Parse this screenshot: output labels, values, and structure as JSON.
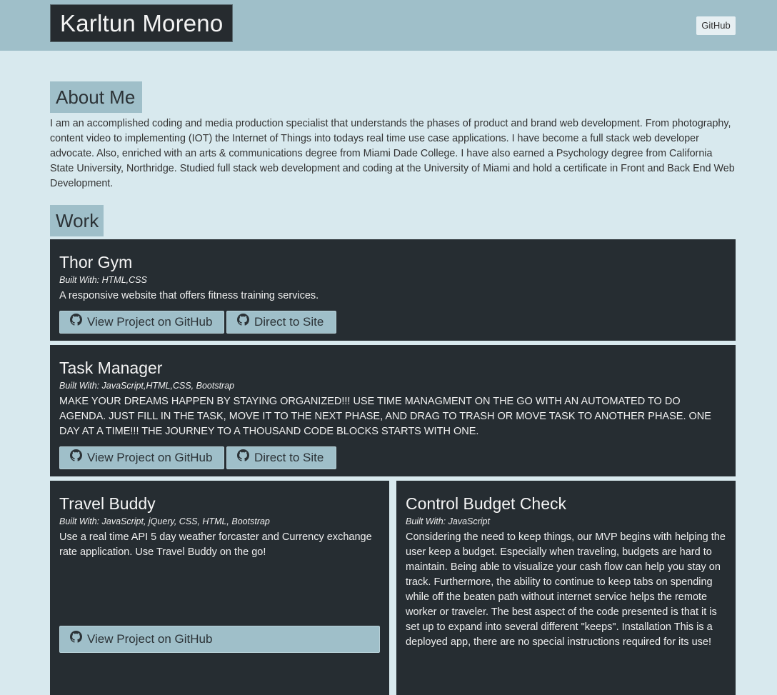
{
  "header": {
    "brand": "Karltun Moreno",
    "github_link": "GitHub"
  },
  "about": {
    "title": "About Me",
    "text": "I am an accomplished coding and media production specialist that understands the phases of product and brand web development. From photography, content video to implementing (IOT) the Internet of Things into todays real time use case applications. I have become a full stack web developer advocate. Also, enriched with an arts & communications degree from Miami Dade College. I have also earned a Psychology degree from California State University, Northridge. Studied full stack web development and coding at the University of Miami and hold a certificate in Front and Back End Web Development."
  },
  "work": {
    "title": "Work",
    "projects": [
      {
        "name": "Thor Gym",
        "built": "Built With: HTML,CSS",
        "description": "A responsive website that offers fitness training services.",
        "github_button": "View Project on GitHub",
        "site_button": "Direct to Site"
      },
      {
        "name": "Task Manager",
        "built": "Built With: JavaScript,HTML,CSS, Bootstrap",
        "description": "MAKE YOUR DREAMS HAPPEN BY STAYING ORGANIZED!!! USE TIME MANAGMENT ON THE GO WITH AN AUTOMATED TO DO AGENDA. JUST FILL IN THE TASK, MOVE IT TO THE NEXT PHASE, AND DRAG TO TRASH OR MOVE TASK TO ANOTHER PHASE. ONE DAY AT A TIME!!! THE JOURNEY TO A THOUSAND CODE BLOCKS STARTS WITH ONE.",
        "github_button": "View Project on GitHub",
        "site_button": "Direct to Site"
      },
      {
        "name": "Travel Buddy",
        "built": "Built With: JavaScript, jQuery, CSS, HTML, Bootstrap",
        "description": "Use a real time API 5 day weather forcaster and Currency exchange rate application. Use Travel Buddy on the go!",
        "github_button": "View Project on GitHub"
      },
      {
        "name": "Control Budget Check",
        "built": "Built With: JavaScript",
        "description": "Considering the need to keep things, our MVP begins with helping the user keep a budget. Especially when traveling, budgets are hard to maintain. Being able to visualize your cash flow can help you stay on track. Furthermore, the ability to continue to keep tabs on spending while off the beaten path without internet service helps the remote worker or traveler. The best aspect of the code presented is that it is set up to expand into several different \"keeps\". Installation This is a deployed app, there are no special instructions required for its use!"
      }
    ]
  },
  "colors": {
    "page_bg": "#d8e9ee",
    "accent": "#9fbfc9",
    "card_bg": "#262d32"
  }
}
